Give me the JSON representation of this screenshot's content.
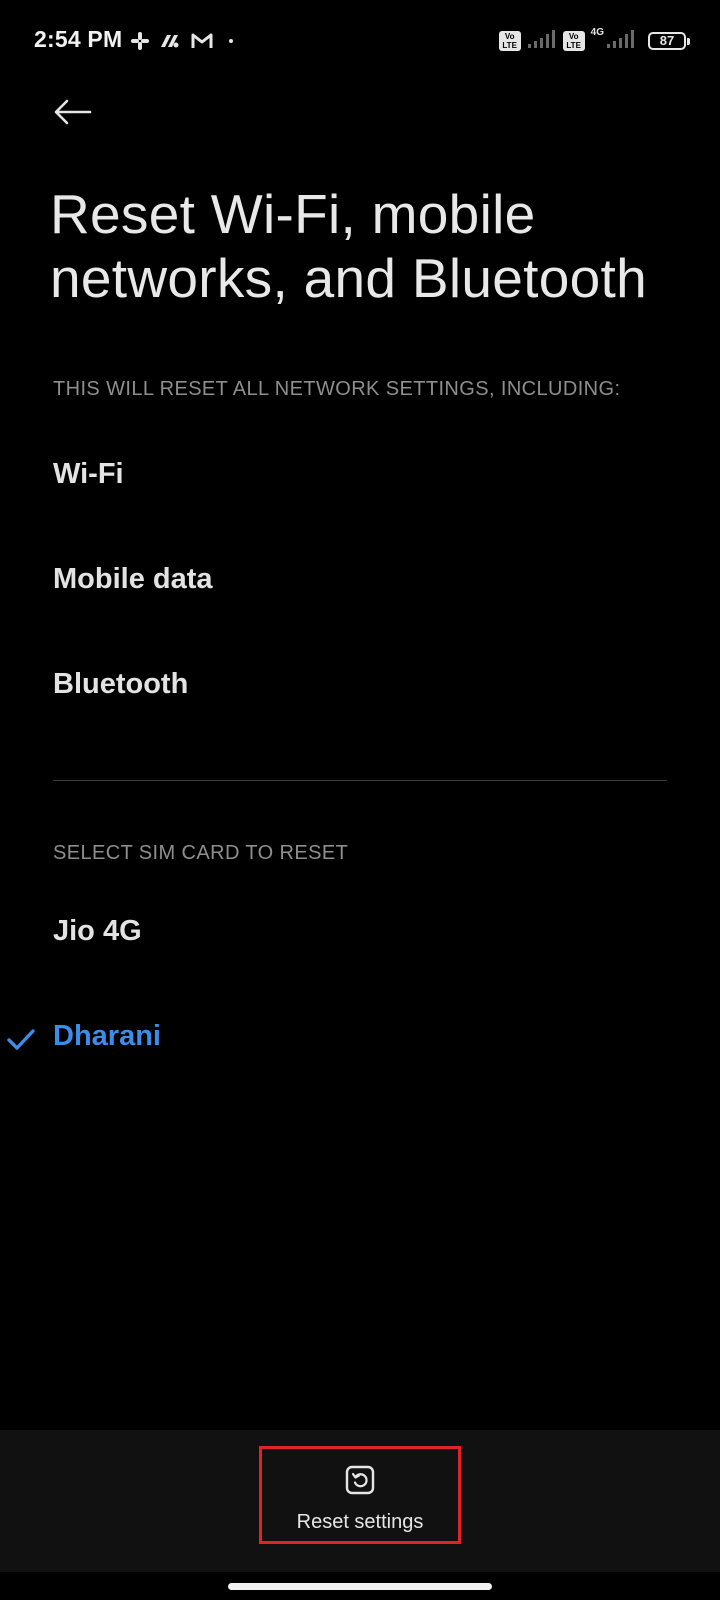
{
  "status_bar": {
    "time": "2:54 PM",
    "notification_icons": [
      "slack-icon",
      "pinwheel-app-icon",
      "gmail-icon",
      "dot-icon"
    ],
    "sim1_badge": [
      "Vo",
      "LTE"
    ],
    "sim2_badge": [
      "Vo",
      "LTE"
    ],
    "sim2_network": "4G",
    "battery_level": "87"
  },
  "header": {
    "back_icon": "arrow-left-icon",
    "title": "Reset Wi-Fi, mobile networks, and Bluetooth"
  },
  "network_section": {
    "header": "THIS WILL RESET ALL NETWORK SETTINGS, INCLUDING:",
    "items": [
      {
        "label": "Wi-Fi"
      },
      {
        "label": "Mobile data"
      },
      {
        "label": "Bluetooth"
      }
    ]
  },
  "sim_section": {
    "header": "SELECT SIM CARD TO RESET",
    "options": [
      {
        "label": "Jio 4G",
        "selected": false
      },
      {
        "label": "Dharani",
        "selected": true
      }
    ]
  },
  "bottom_bar": {
    "reset_label": "Reset settings",
    "reset_icon": "reset-rotate-icon"
  },
  "colors": {
    "background": "#000000",
    "accent": "#3c8ce8",
    "highlight": "#e0232b",
    "bottom_bar": "#111111"
  }
}
